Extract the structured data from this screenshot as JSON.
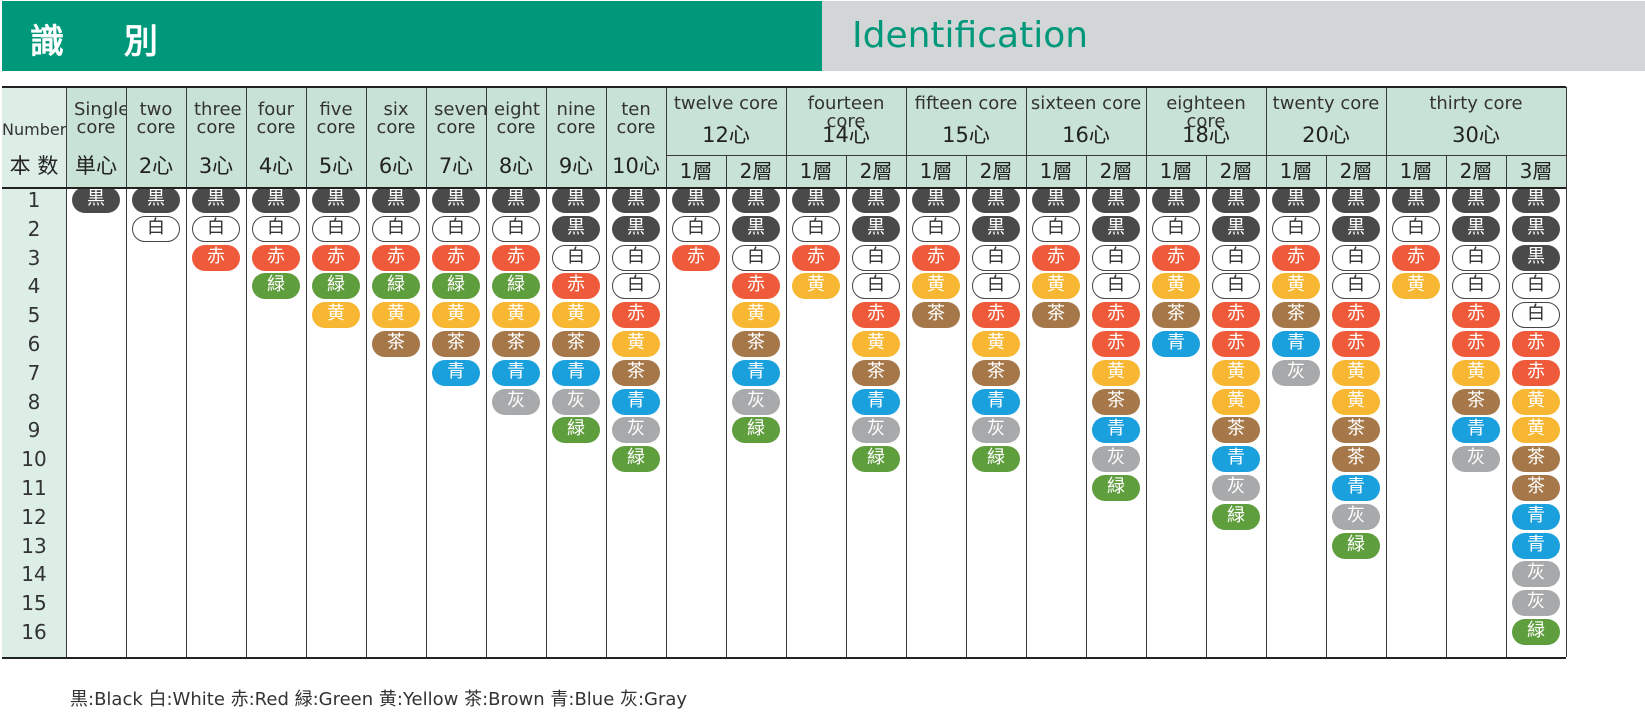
{
  "header": {
    "title_jp": "識 別",
    "title_en": "Identification"
  },
  "table": {
    "number_label_en": "Number",
    "number_label_jp": "本 数",
    "row_numbers": [
      "1",
      "2",
      "3",
      "4",
      "5",
      "6",
      "7",
      "8",
      "9",
      "10",
      "11",
      "12",
      "13",
      "14",
      "15",
      "16"
    ],
    "groups": [
      {
        "en": "Single core",
        "jp": "単心",
        "layers": [
          [
            "黒"
          ]
        ]
      },
      {
        "en": "two core",
        "jp": "2心",
        "layers": [
          [
            "黒",
            "白"
          ]
        ]
      },
      {
        "en": "three core",
        "jp": "3心",
        "layers": [
          [
            "黒",
            "白",
            "赤"
          ]
        ]
      },
      {
        "en": "four core",
        "jp": "4心",
        "layers": [
          [
            "黒",
            "白",
            "赤",
            "緑"
          ]
        ]
      },
      {
        "en": "five core",
        "jp": "5心",
        "layers": [
          [
            "黒",
            "白",
            "赤",
            "緑",
            "黄"
          ]
        ]
      },
      {
        "en": "six core",
        "jp": "6心",
        "layers": [
          [
            "黒",
            "白",
            "赤",
            "緑",
            "黄",
            "茶"
          ]
        ]
      },
      {
        "en": "seven core",
        "jp": "7心",
        "layers": [
          [
            "黒",
            "白",
            "赤",
            "緑",
            "黄",
            "茶",
            "青"
          ]
        ]
      },
      {
        "en": "eight core",
        "jp": "8心",
        "layers": [
          [
            "黒",
            "白",
            "赤",
            "緑",
            "黄",
            "茶",
            "青",
            "灰"
          ]
        ]
      },
      {
        "en": "nine core",
        "jp": "9心",
        "layers": [
          [
            "黒",
            "黒",
            "白",
            "赤",
            "黄",
            "茶",
            "青",
            "灰",
            "緑"
          ]
        ]
      },
      {
        "en": "ten core",
        "jp": "10心",
        "layers": [
          [
            "黒",
            "黒",
            "白",
            "白",
            "赤",
            "黄",
            "茶",
            "青",
            "灰",
            "緑"
          ]
        ]
      },
      {
        "en": "twelve core",
        "jp": "12心",
        "sub": [
          "1層",
          "2層"
        ],
        "layers": [
          [
            "黒",
            "白",
            "赤"
          ],
          [
            "黒",
            "黒",
            "白",
            "赤",
            "黄",
            "茶",
            "青",
            "灰",
            "緑"
          ]
        ]
      },
      {
        "en": "fourteen core",
        "jp": "14心",
        "sub": [
          "1層",
          "2層"
        ],
        "layers": [
          [
            "黒",
            "白",
            "赤",
            "黄"
          ],
          [
            "黒",
            "黒",
            "白",
            "白",
            "赤",
            "黄",
            "茶",
            "青",
            "灰",
            "緑"
          ]
        ]
      },
      {
        "en": "fifteen core",
        "jp": "15心",
        "sub": [
          "1層",
          "2層"
        ],
        "layers": [
          [
            "黒",
            "白",
            "赤",
            "黄",
            "茶"
          ],
          [
            "黒",
            "黒",
            "白",
            "白",
            "赤",
            "黄",
            "茶",
            "青",
            "灰",
            "緑"
          ]
        ]
      },
      {
        "en": "sixteen core",
        "jp": "16心",
        "sub": [
          "1層",
          "2層"
        ],
        "layers": [
          [
            "黒",
            "白",
            "赤",
            "黄",
            "茶"
          ],
          [
            "黒",
            "黒",
            "白",
            "白",
            "赤",
            "赤",
            "黄",
            "茶",
            "青",
            "灰",
            "緑"
          ]
        ]
      },
      {
        "en": "eighteen core",
        "jp": "18心",
        "sub": [
          "1層",
          "2層"
        ],
        "layers": [
          [
            "黒",
            "白",
            "赤",
            "黄",
            "茶",
            "青"
          ],
          [
            "黒",
            "黒",
            "白",
            "白",
            "赤",
            "赤",
            "黄",
            "黄",
            "茶",
            "青",
            "灰",
            "緑"
          ]
        ]
      },
      {
        "en": "twenty core",
        "jp": "20心",
        "sub": [
          "1層",
          "2層"
        ],
        "layers": [
          [
            "黒",
            "白",
            "赤",
            "黄",
            "茶",
            "青",
            "灰"
          ],
          [
            "黒",
            "黒",
            "白",
            "白",
            "赤",
            "赤",
            "黄",
            "黄",
            "茶",
            "茶",
            "青",
            "灰",
            "緑"
          ]
        ]
      },
      {
        "en": "thirty core",
        "jp": "30心",
        "sub": [
          "1層",
          "2層",
          "3層"
        ],
        "layers": [
          [
            "黒",
            "白",
            "赤",
            "黄"
          ],
          [
            "黒",
            "黒",
            "白",
            "白",
            "赤",
            "赤",
            "黄",
            "茶",
            "青",
            "灰"
          ],
          [
            "黒",
            "黒",
            "黒",
            "白",
            "白",
            "赤",
            "赤",
            "黄",
            "黄",
            "茶",
            "茶",
            "青",
            "青",
            "灰",
            "灰",
            "緑"
          ]
        ]
      }
    ]
  },
  "colors": {
    "黒": "#4a4a4a",
    "白": "#ffffff",
    "赤": "#ee5a3a",
    "緑": "#5f9e3d",
    "黄": "#f7b733",
    "茶": "#a67849",
    "青": "#1aa0dc",
    "灰": "#a8a9aa"
  },
  "legend": "黒:Black 白:White 赤:Red 緑:Green 黄:Yellow 茶:Brown 青:Blue 灰:Gray"
}
